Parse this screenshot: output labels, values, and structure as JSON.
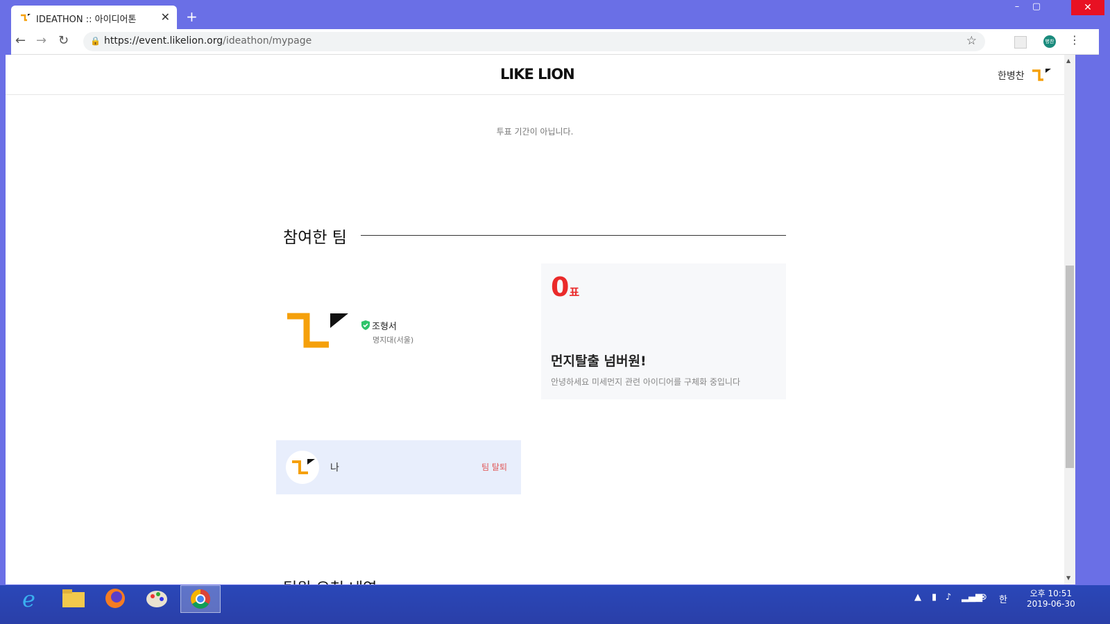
{
  "browser": {
    "tab_title": "IDEATHON :: 아이디어톤",
    "tab_close": "✕",
    "new_tab": "+",
    "url_host": "https://event.likelion.org",
    "url_path": "/ideathon/mypage",
    "profile_initials": "병찬"
  },
  "window": {
    "minimize": "–",
    "maximize": "▢",
    "close": "✕"
  },
  "header": {
    "logo": "LIKE LION",
    "username": "한병찬"
  },
  "notice": "투표 기간이 아닙니다.",
  "section": {
    "title": "참여한 팀",
    "next_title": "팀원 요청 내역"
  },
  "team": {
    "leader_name": "조형서",
    "leader_school": "명지대(서울)",
    "votes": "0",
    "votes_unit": "표",
    "title": "먼지탈출 넘버원!",
    "description": "안녕하세요 미세먼지 관련 아이디어를 구체화 중입니다"
  },
  "member": {
    "name": "나",
    "leave_label": "팀 탈퇴"
  },
  "taskbar": {
    "clock_ampm_time": "오후 10:51",
    "clock_date": "2019-06-30",
    "ime": "한"
  },
  "colors": {
    "accent_orange": "#f5a00b",
    "vote_red": "#ea2a2a",
    "titlebar": "#6a6fe6"
  }
}
